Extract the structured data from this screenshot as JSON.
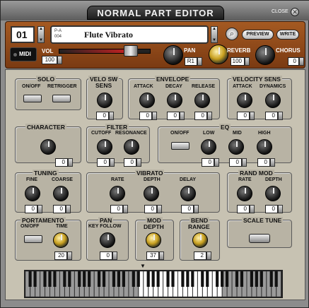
{
  "window": {
    "title": "NORMAL PART EDITOR",
    "close_label": "CLOSE",
    "close_icon": "close-icon"
  },
  "top": {
    "part": "01",
    "bank_line1": "P-A",
    "bank_line2": "004",
    "patch_name": "Flute Vibrato",
    "preview": "PREVIEW",
    "write": "WRITE",
    "midi": "MIDI",
    "vol_label": "VOL",
    "vol_value": "100",
    "vol_level": 100,
    "pan_label": "PAN",
    "pan_value": "R1",
    "reverb_label": "REVERB",
    "reverb_value": "100",
    "chorus_label": "CHORUS",
    "chorus_value": "0"
  },
  "solo": {
    "title": "SOLO",
    "onoff": "ON/OFF",
    "retrigger": "RETRIGGER"
  },
  "velo": {
    "title1": "VELO SW",
    "title2": "SENS",
    "value": "0"
  },
  "envelope": {
    "title": "ENVELOPE",
    "attack": "ATTACK",
    "decay": "DECAY",
    "release": "RELEASE",
    "v1": "0",
    "v2": "0",
    "v3": "0"
  },
  "velsens": {
    "title": "VELOCITY SENS",
    "attack": "ATTACK",
    "dynamics": "DYNAMICS",
    "v1": "0",
    "v2": "0"
  },
  "character": {
    "title": "CHARACTER",
    "value": "0"
  },
  "filter": {
    "title": "FILTER",
    "cutoff": "CUTOFF",
    "resonance": "RESONANCE",
    "v1": "0",
    "v2": "0"
  },
  "eq": {
    "title": "EQ",
    "onoff": "ON/OFF",
    "low": "LOW",
    "mid": "MID",
    "high": "HIGH",
    "v1": "0",
    "v2": "0",
    "v3": "0"
  },
  "tuning": {
    "title": "TUNING",
    "fine": "FINE",
    "coarse": "COARSE",
    "v1": "0",
    "v2": "0"
  },
  "vibrato": {
    "title": "VIBRATO",
    "rate": "RATE",
    "depth": "DEPTH",
    "delay": "DELAY",
    "v1": "0",
    "v2": "0",
    "v3": "0"
  },
  "randmod": {
    "title": "RAND MOD",
    "rate": "RATE",
    "depth": "DEPTH",
    "v1": "0",
    "v2": "0"
  },
  "portamento": {
    "title": "PORTAMENTO",
    "onoff": "ON/OFF",
    "time": "TIME",
    "value": "20"
  },
  "pan": {
    "title": "PAN",
    "sub": "KEY FOLLOW",
    "value": "0"
  },
  "moddepth": {
    "title1": "MOD",
    "title2": "DEPTH",
    "value": "37"
  },
  "bend": {
    "title1": "BEND",
    "title2": "RANGE",
    "value": "2"
  },
  "scaletune": {
    "title": "SCALE TUNE"
  }
}
